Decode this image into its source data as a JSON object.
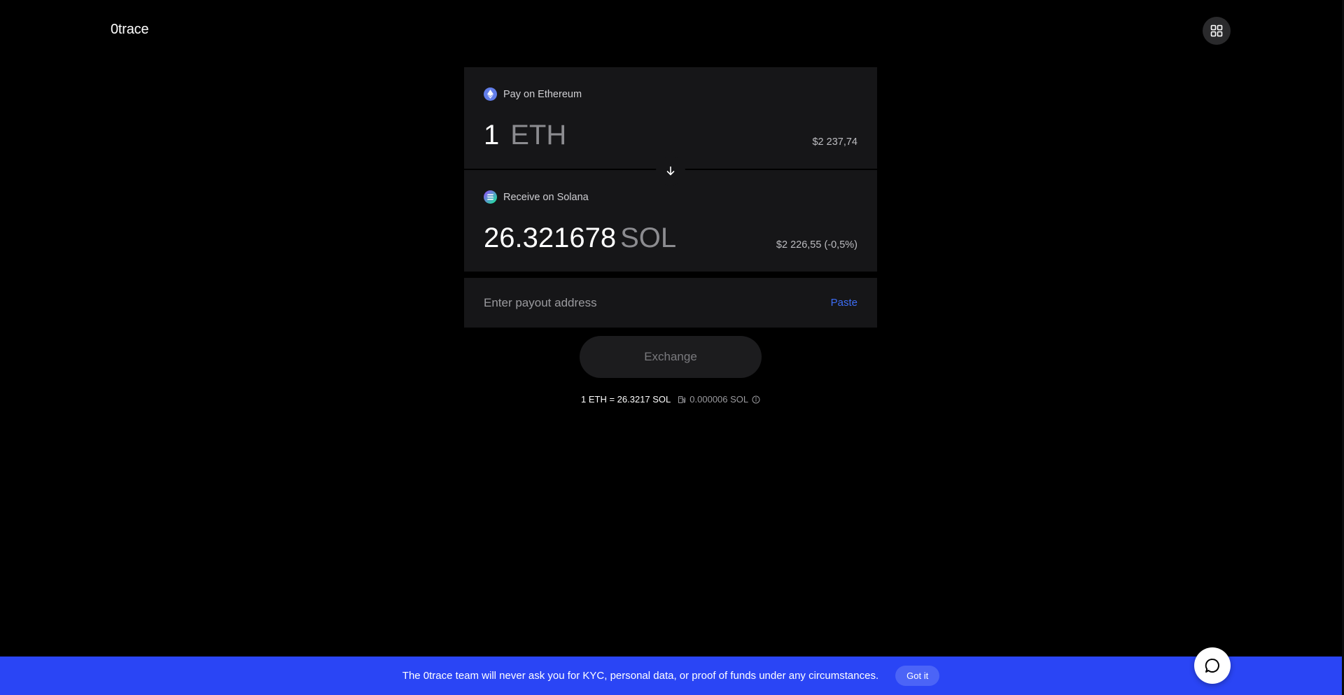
{
  "header": {
    "logo": "0trace",
    "menu_icon": "grid-icon"
  },
  "swap": {
    "pay": {
      "label": "Pay on Ethereum",
      "amount": "1",
      "ticker": "ETH",
      "usd_value": "$2 237,74",
      "icon": "ethereum-icon"
    },
    "receive": {
      "label": "Receive on Solana",
      "amount": "26.321678",
      "ticker": "SOL",
      "usd_value": "$2 226,55 (-0,5%)",
      "icon": "solana-icon"
    },
    "toggle_icon": "arrow-down-icon"
  },
  "address": {
    "placeholder": "Enter payout address",
    "value": "",
    "paste_label": "Paste"
  },
  "exchange_button": "Exchange",
  "rate": {
    "text": "1 ETH = 26.3217 SOL",
    "fee": "0.000006 SOL",
    "fee_icon": "gas-pump-icon",
    "info_icon": "info-icon"
  },
  "banner": {
    "text": "The 0trace team will never ask you for KYC, personal data, or proof of funds under any circumstances.",
    "button": "Got it",
    "color": "#2a45f5"
  },
  "chat_icon": "chat-bubble-icon"
}
